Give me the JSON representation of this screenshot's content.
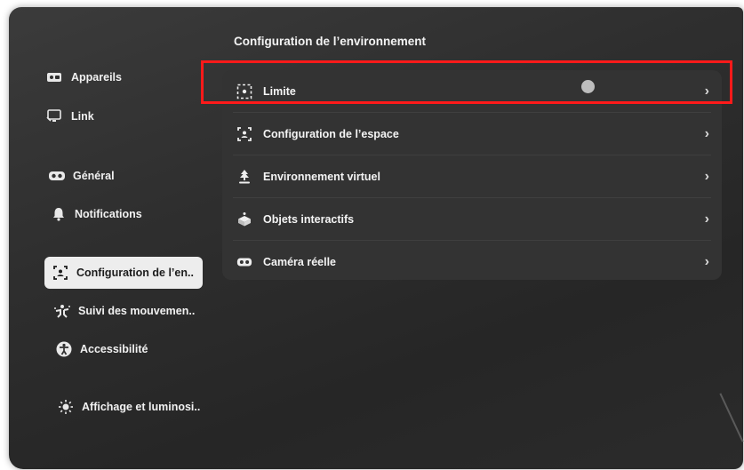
{
  "header": {
    "title": "Configuration de l’environnement"
  },
  "sidebar": {
    "items": [
      {
        "label": "Appareils",
        "icon": "devices-icon"
      },
      {
        "label": "Link",
        "icon": "link-monitor-icon"
      },
      {
        "label": "Général",
        "icon": "headset-icon"
      },
      {
        "label": "Notifications",
        "icon": "bell-icon"
      },
      {
        "label": "Configuration de l’en..",
        "icon": "space-setup-icon",
        "active": true
      },
      {
        "label": "Suivi des mouvemen..",
        "icon": "motion-tracking-icon"
      },
      {
        "label": "Accessibilité",
        "icon": "accessibility-icon"
      },
      {
        "label": "Affichage et luminosi..",
        "icon": "brightness-icon"
      }
    ]
  },
  "main": {
    "items": [
      {
        "label": "Limite",
        "icon": "boundary-icon"
      },
      {
        "label": "Configuration de l’espace",
        "icon": "space-setup-icon"
      },
      {
        "label": "Environnement virtuel",
        "icon": "virtual-environment-icon"
      },
      {
        "label": "Objets interactifs",
        "icon": "interactive-objects-icon"
      },
      {
        "label": "Caméra réelle",
        "icon": "passthrough-camera-icon"
      }
    ]
  },
  "colors": {
    "highlight": "#ff1a1a",
    "active_bg": "#ededed",
    "panel_bg": "#2f2f2f"
  }
}
